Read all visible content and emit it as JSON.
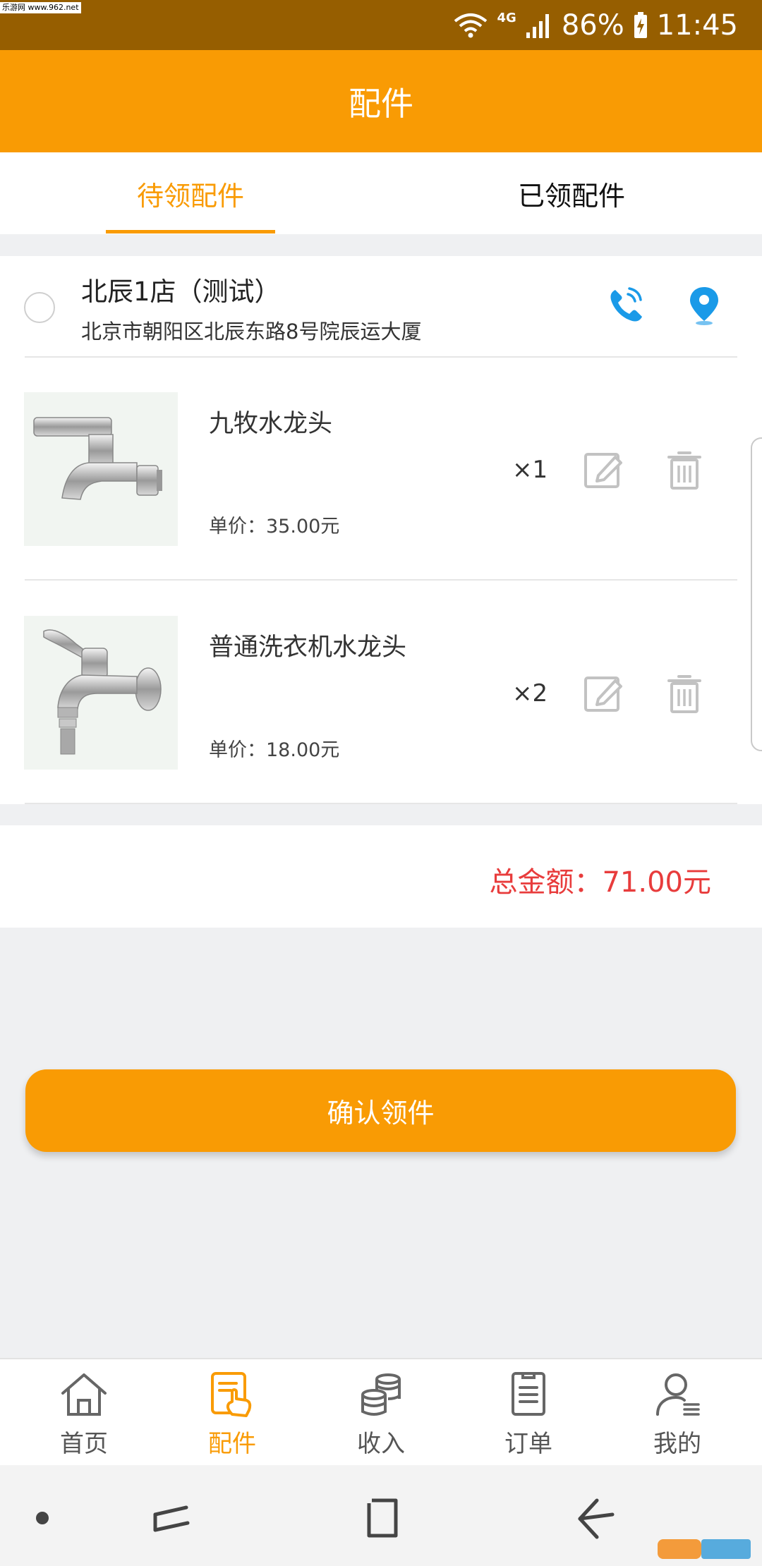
{
  "watermark": "乐游网 www.962.net",
  "status_bar": {
    "network_type": "4G",
    "battery": "86%",
    "time": "11:45"
  },
  "header": {
    "title": "配件"
  },
  "tabs": [
    {
      "label": "待领配件",
      "active": true
    },
    {
      "label": "已领配件",
      "active": false
    }
  ],
  "store": {
    "name": "北辰1店（测试）",
    "address": "北京市朝阳区北辰东路8号院辰运大厦",
    "phone_icon": "phone-icon",
    "location_icon": "location-pin-icon"
  },
  "items": [
    {
      "name": "九牧水龙头",
      "price": "单价：35.00元",
      "qty": "×1"
    },
    {
      "name": "普通洗衣机水龙头",
      "price": "单价：18.00元",
      "qty": "×2"
    }
  ],
  "total": "总金额：71.00元",
  "confirm_label": "确认领件",
  "bottom_nav": [
    {
      "label": "首页",
      "icon": "home-icon",
      "active": false
    },
    {
      "label": "配件",
      "icon": "parts-icon",
      "active": true
    },
    {
      "label": "收入",
      "icon": "coins-icon",
      "active": false
    },
    {
      "label": "订单",
      "icon": "order-icon",
      "active": false
    },
    {
      "label": "我的",
      "icon": "user-icon",
      "active": false
    }
  ],
  "colors": {
    "accent": "#f99b04",
    "status_bar": "#965e00",
    "total_red": "#e83c3c",
    "icon_blue": "#1a9ae8"
  }
}
